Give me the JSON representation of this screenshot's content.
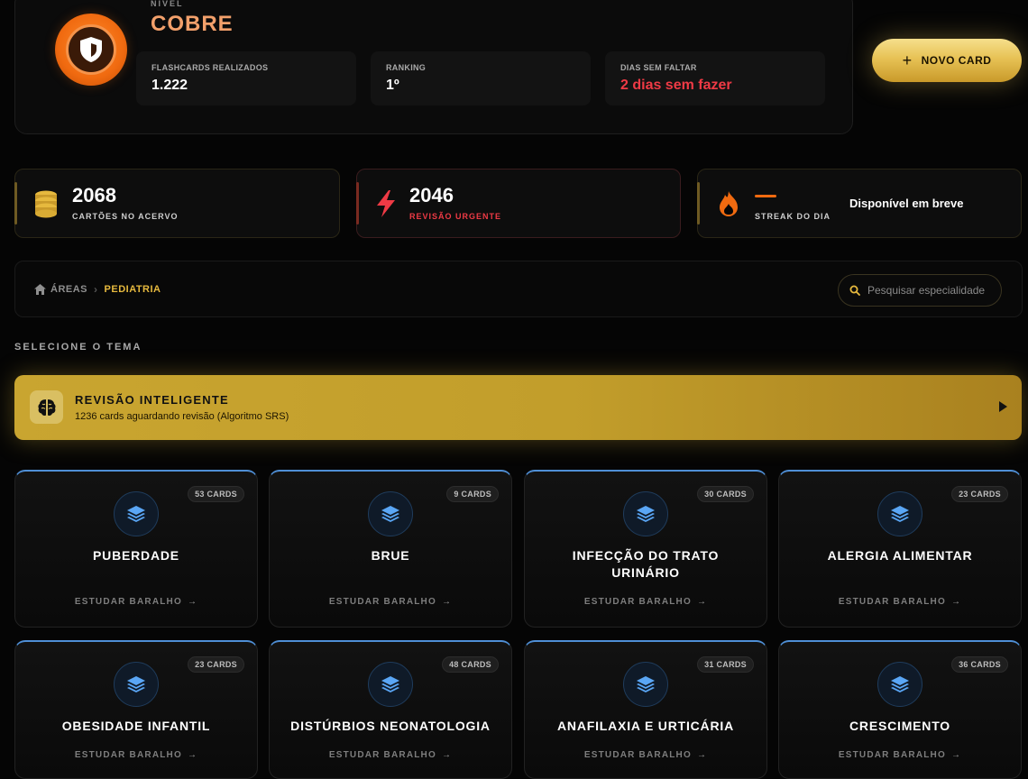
{
  "header": {
    "level_label": "NÍVEL",
    "level_name": "COBRE",
    "stats": [
      {
        "label": "FLASHCARDS REALIZADOS",
        "value": "1.222"
      },
      {
        "label": "RANKING",
        "value": "1º"
      },
      {
        "label": "DIAS SEM FALTAR",
        "value": "2 dias sem fazer"
      }
    ],
    "new_card_label": "NOVO CARD"
  },
  "metrics": [
    {
      "value": "2068",
      "caption": "CARTÕES NO ACERVO"
    },
    {
      "value": "2046",
      "caption": "REVISÃO URGENTE"
    },
    {
      "value": "",
      "caption": "STREAK DO DIA",
      "note": "Disponível em breve"
    }
  ],
  "breadcrumb": {
    "root": "ÁREAS",
    "current": "PEDIATRIA"
  },
  "search": {
    "placeholder": "Pesquisar especialidade"
  },
  "section_title": "SELECIONE O TEMA",
  "smart_review": {
    "title": "REVISÃO INTELIGENTE",
    "subtitle": "1236 cards aguardando revisão (Algoritmo SRS)"
  },
  "decks": [
    {
      "title": "PUBERDADE",
      "count": "53 CARDS",
      "cta": "ESTUDAR BARALHO"
    },
    {
      "title": "BRUE",
      "count": "9 CARDS",
      "cta": "ESTUDAR BARALHO"
    },
    {
      "title": "INFECÇÃO DO TRATO URINÁRIO",
      "count": "30 CARDS",
      "cta": "ESTUDAR BARALHO"
    },
    {
      "title": "ALERGIA ALIMENTAR",
      "count": "23 CARDS",
      "cta": "ESTUDAR BARALHO"
    },
    {
      "title": "OBESIDADE INFANTIL",
      "count": "23 CARDS",
      "cta": "ESTUDAR BARALHO"
    },
    {
      "title": "DISTÚRBIOS NEONATOLOGIA",
      "count": "48 CARDS",
      "cta": "ESTUDAR BARALHO"
    },
    {
      "title": "ANAFILAXIA E URTICÁRIA",
      "count": "31 CARDS",
      "cta": "ESTUDAR BARALHO"
    },
    {
      "title": "CRESCIMENTO",
      "count": "36 CARDS",
      "cta": "ESTUDAR BARALHO"
    }
  ],
  "colors": {
    "accent_gold": "#e6b93e",
    "level_copper": "#f06a10",
    "urgent_red": "#ef3a45",
    "deck_blue": "#4f8fd6"
  }
}
